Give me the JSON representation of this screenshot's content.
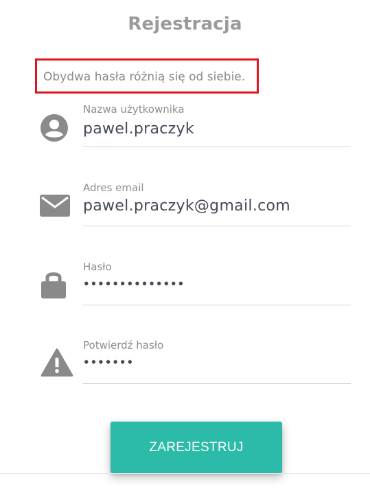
{
  "form": {
    "title": "Rejestracja",
    "error_message": "Obydwa hasła różnią się od siebie.",
    "submit_label": "ZAREJESTRUJ"
  },
  "fields": [
    {
      "label": "Nazwa użytkownika",
      "value": "pawel.praczyk",
      "icon": "account-circle-icon"
    },
    {
      "label": "Adres email",
      "value": "pawel.praczyk@gmail.com",
      "icon": "envelope-icon"
    },
    {
      "label": "Hasło",
      "value": "••••••••••••••",
      "icon": "lock-icon"
    },
    {
      "label": "Potwierdź hasło",
      "value": "•••••••",
      "icon": "warning-icon"
    }
  ],
  "colors": {
    "accent": "#2bbba8",
    "error_border": "#e0141e",
    "icon": "#8a8a8a",
    "text": "#444a55",
    "label": "#8d8d8d"
  }
}
